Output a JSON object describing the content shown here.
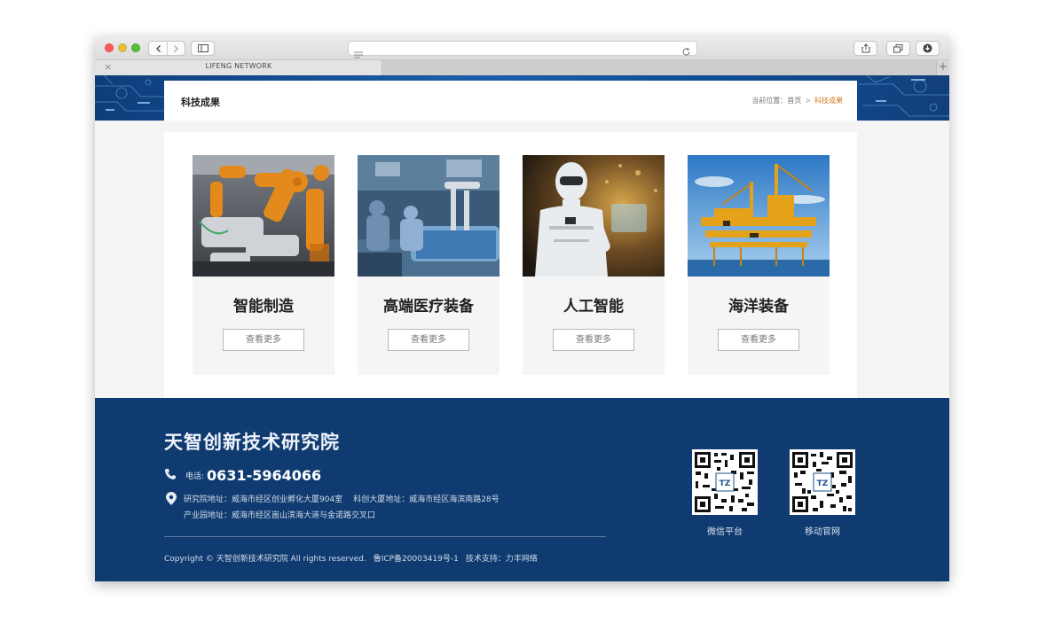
{
  "browser": {
    "tab_title": "LIFENG NETWORK",
    "tab_close": "×",
    "new_tab": "+"
  },
  "breadcrumb": {
    "section_title": "科技成果",
    "prefix": "当前位置：",
    "home": "首页",
    "separator": ">",
    "current": "科技成果"
  },
  "cards": [
    {
      "title": "智能制造",
      "button": "查看更多",
      "image": "industrial-robot-arms"
    },
    {
      "title": "高端医疗装备",
      "button": "查看更多",
      "image": "surgical-robot-operating-room"
    },
    {
      "title": "人工智能",
      "button": "查看更多",
      "image": "humanoid-robot"
    },
    {
      "title": "海洋装备",
      "button": "查看更多",
      "image": "offshore-oil-platform"
    }
  ],
  "footer": {
    "org_name": "天智创新技术研究院",
    "phone_label": "电话:",
    "phone": "0631-5964066",
    "address_1": "研究院地址：威海市经区创业孵化大厦904室",
    "address_2": "科创大厦地址：威海市经区海滨南路28号",
    "address_3": "产业园地址：威海市经区崮山滨海大道与金诺路交叉口",
    "copyright": "Copyright © 天智创新技术研究院 All rights reserved.",
    "icp": "鲁ICP备20003419号-1",
    "support": "技术支持：力丰网络",
    "qr": [
      {
        "label": "微信平台",
        "center_text": "TZ"
      },
      {
        "label": "移动官网",
        "center_text": "TZ"
      }
    ]
  },
  "colors": {
    "footer_bg": "#0f3b70",
    "breadcrumb_current": "#d4781c",
    "banner_blue": "#1b5ea8"
  }
}
